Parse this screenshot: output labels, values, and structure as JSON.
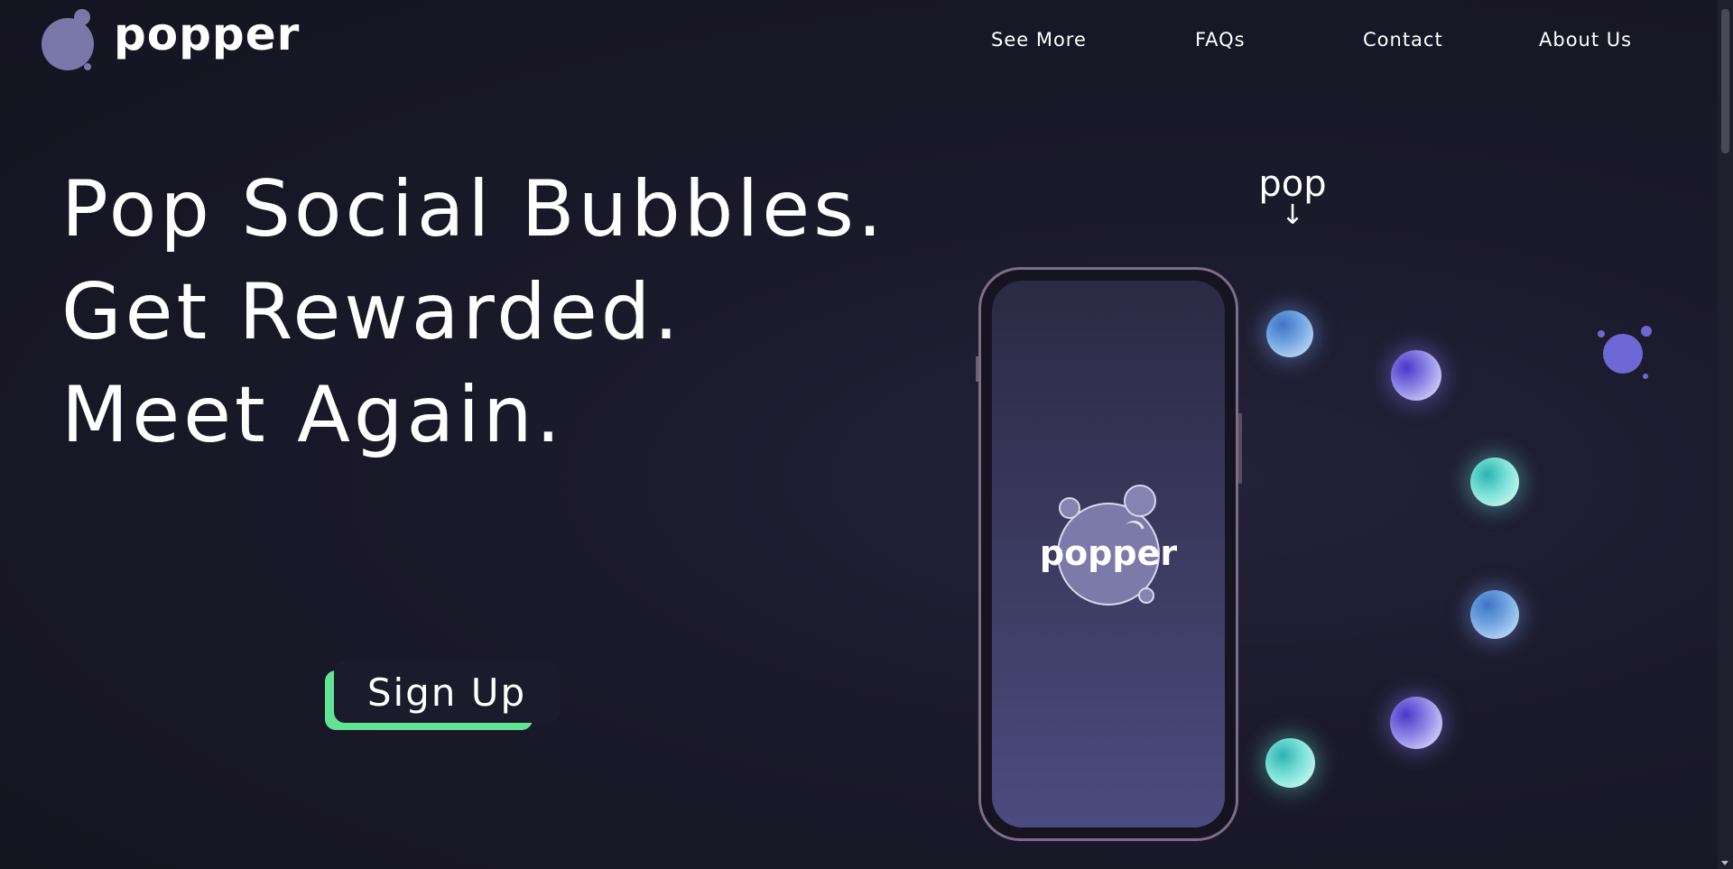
{
  "brand": {
    "name": "popper",
    "logo_icon": "bubbles-logo-icon",
    "logo_color": "#7a78a8"
  },
  "nav": {
    "items": [
      {
        "label": "See More"
      },
      {
        "label": "FAQs"
      },
      {
        "label": "Contact"
      },
      {
        "label": "About Us"
      }
    ]
  },
  "hero": {
    "lines": [
      "Pop Social Bubbles.",
      "Get Rewarded.",
      "Meet Again."
    ],
    "cta_label": "Sign Up",
    "cta_accent_color": "#62e497"
  },
  "illustration": {
    "pop_label": "pop",
    "arrow": "↓",
    "phone_logo_text": "popper",
    "bubble_colors": [
      "blue",
      "violet",
      "teal",
      "blue",
      "violet",
      "teal"
    ]
  },
  "colors": {
    "background": "#171624",
    "text": "#ffffff",
    "accent_green": "#62e497",
    "accent_violet": "#6e67d6"
  }
}
